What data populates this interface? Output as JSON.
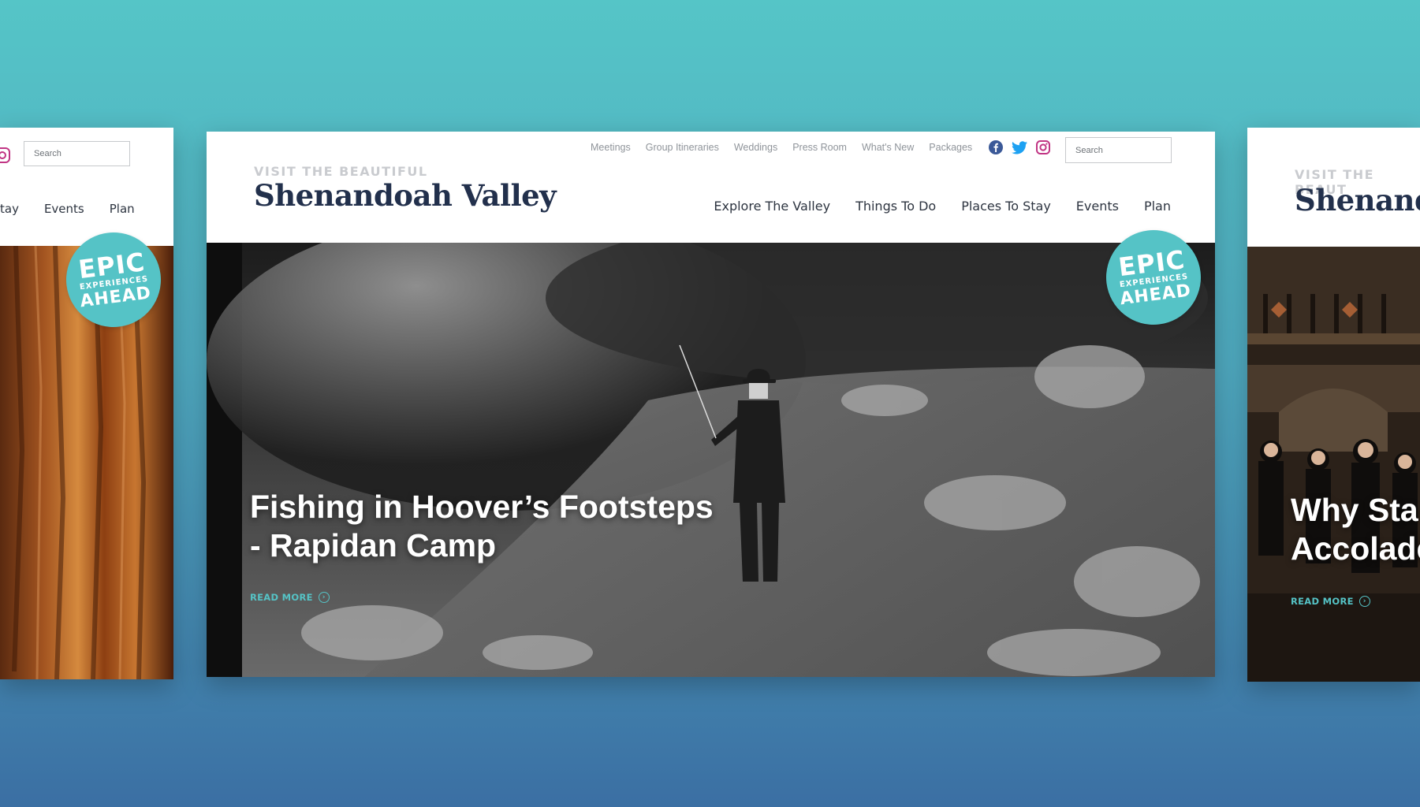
{
  "main_card": {
    "tagline": "VISIT THE BEAUTIFUL",
    "brand": "Shenandoah Valley",
    "utility_nav": [
      "Meetings",
      "Group Itineraries",
      "Weddings",
      "Press Room",
      "What's New",
      "Packages"
    ],
    "social_icons": [
      "facebook-icon",
      "twitter-icon",
      "instagram-icon"
    ],
    "search_placeholder": "Search",
    "main_nav": [
      "Explore The Valley",
      "Things To Do",
      "Places To Stay",
      "Events",
      "Plan"
    ],
    "badge": {
      "line1": "EPIC",
      "line2": "EXPERIENCES",
      "line3": "AHEAD"
    },
    "headline_line1": "Fishing in Hoover’s Footsteps",
    "headline_line2": "- Rapidan Camp",
    "read_more": "READ MORE"
  },
  "left_card": {
    "search_placeholder": "Search",
    "nav_partial": "tay",
    "nav": [
      "Events",
      "Plan"
    ],
    "badge": {
      "line1": "EPIC",
      "line2": "EXPERIENCES",
      "line3": "AHEAD"
    }
  },
  "right_card": {
    "tagline": "VISIT THE BEAUT",
    "brand": "Shenando",
    "headline_line1": "Why Sta",
    "headline_line2": "Accolade",
    "read_more": "READ MORE"
  },
  "colors": {
    "accent": "#55c3c6",
    "brand_navy": "#22304c",
    "facebook": "#3b5998",
    "twitter": "#1da1f2",
    "instagram": "#c13584"
  }
}
